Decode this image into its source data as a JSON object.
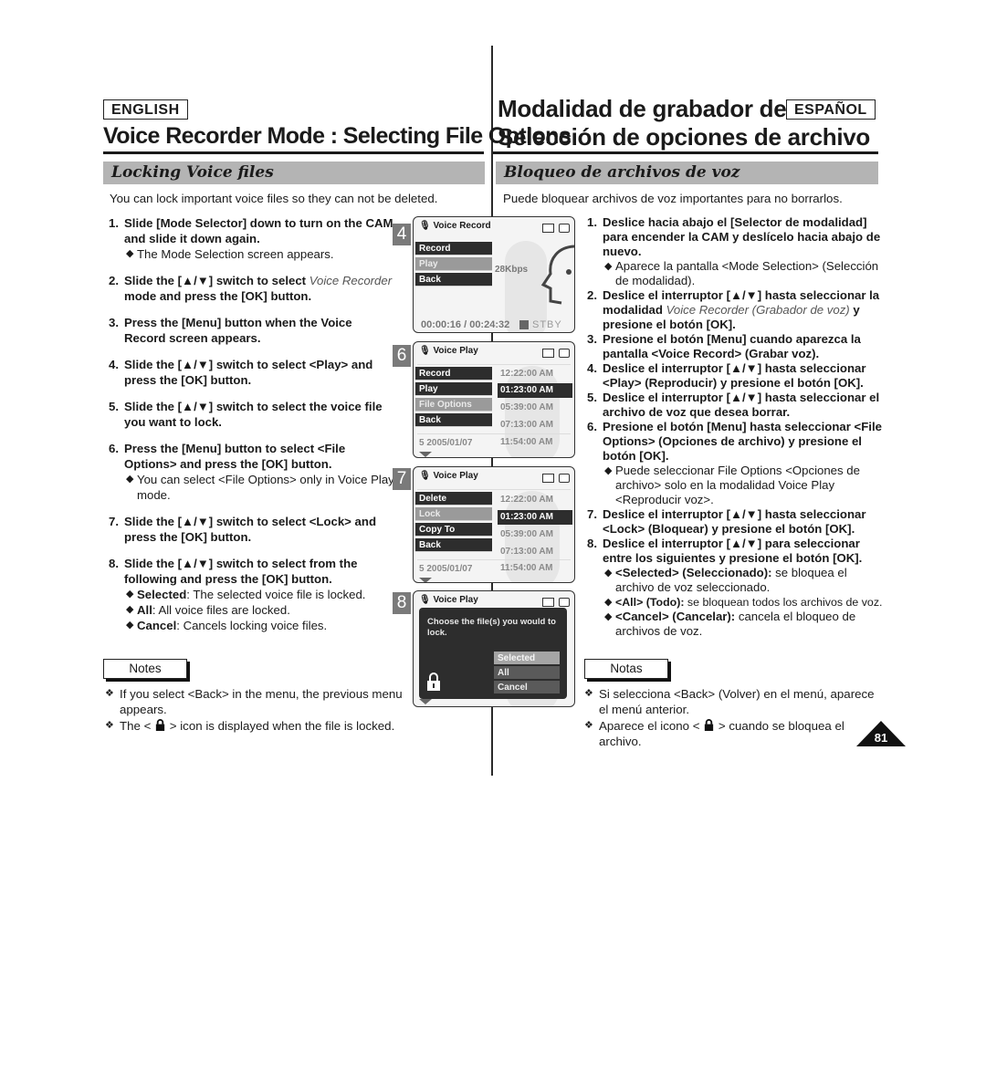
{
  "header": {
    "english_label": "ENGLISH",
    "spanish_label": "ESPAÑOL",
    "title_en": "Voice Recorder Mode : Selecting File Options",
    "title_es_line1": "Modalidad de grabador de voz:",
    "title_es_line2": "Selección de opciones de archivo"
  },
  "english": {
    "section_title": "Locking Voice files",
    "intro": "You can lock important voice files so they can not be deleted.",
    "steps": [
      {
        "num": "1.",
        "text": "Slide [Mode Selector] down to turn on the CAM and slide it down again.",
        "subs": [
          "The Mode Selection screen appears."
        ]
      },
      {
        "num": "2.",
        "pre": "Slide the [▲/▼] switch to select ",
        "italic": "Voice Recorder",
        "post": " mode and press the [OK] button."
      },
      {
        "num": "3.",
        "text": "Press the [Menu] button when the Voice Record screen appears."
      },
      {
        "num": "4.",
        "text": "Slide the [▲/▼] switch to select <Play> and press the [OK] button."
      },
      {
        "num": "5.",
        "text": "Slide the [▲/▼] switch to select the voice file you want to lock."
      },
      {
        "num": "6.",
        "text": "Press the [Menu] button to select <File Options> and press the [OK] button.",
        "subs": [
          "You can select <File Options> only in Voice Play mode."
        ]
      },
      {
        "num": "7.",
        "text": "Slide the [▲/▼] switch to select <Lock> and press the [OK] button."
      },
      {
        "num": "8.",
        "text": "Slide the [▲/▼] switch to select from the following and press the [OK] button.",
        "options": [
          {
            "term": "Selected",
            "desc": ": The selected voice file is locked."
          },
          {
            "term": "All",
            "desc": ": All voice files are locked."
          },
          {
            "term": "Cancel",
            "desc": ": Cancels locking voice files."
          }
        ]
      }
    ],
    "notes_label": "Notes",
    "notes": [
      "If you select <Back> in the menu, the previous menu appears.",
      {
        "pre": "The < ",
        "icon": "lock-icon",
        "post": " > icon is displayed when the file is locked."
      }
    ]
  },
  "spanish": {
    "section_title": "Bloqueo de archivos de voz",
    "intro": "Puede bloquear archivos de voz importantes para no borrarlos.",
    "steps": [
      {
        "num": "1.",
        "text": "Deslice hacia abajo el [Selector de modalidad] para encender la CAM y deslícelo hacia abajo de nuevo.",
        "subs": [
          "Aparece la pantalla <Mode Selection> (Selección de modalidad)."
        ]
      },
      {
        "num": "2.",
        "pre": "Deslice el interruptor [▲/▼] hasta seleccionar la modalidad ",
        "italic": "Voice Recorder (Grabador de voz)",
        "post": " y presione el botón [OK]."
      },
      {
        "num": "3.",
        "text": "Presione el botón [Menu] cuando aparezca la pantalla <Voice Record> (Grabar voz)."
      },
      {
        "num": "4.",
        "text": "Deslice el interruptor [▲/▼] hasta seleccionar <Play> (Reproducir) y presione el botón [OK]."
      },
      {
        "num": "5.",
        "text": "Deslice el interruptor [▲/▼] hasta seleccionar el archivo de voz que desea borrar."
      },
      {
        "num": "6.",
        "text": "Presione el botón [Menu] hasta seleccionar <File Options> (Opciones de archivo) y presione el botón [OK].",
        "subs": [
          "Puede seleccionar File Options <Opciones de archivo> solo en la modalidad Voice Play <Reproducir voz>."
        ]
      },
      {
        "num": "7.",
        "text": "Deslice el interruptor [▲/▼] hasta seleccionar <Lock> (Bloquear) y presione el botón [OK]."
      },
      {
        "num": "8.",
        "text": "Deslice el interruptor [▲/▼] para seleccionar entre los siguientes y presione el botón [OK].",
        "options": [
          {
            "term": "<Selected> (Seleccionado):",
            "desc": " se bloquea el archivo de voz seleccionado."
          },
          {
            "term": "<All> (Todo):",
            "desc": " se bloquean todos los archivos de voz."
          },
          {
            "term": "<Cancel> (Cancelar):",
            "desc": " cancela el bloqueo de archivos de voz."
          }
        ]
      }
    ],
    "notes_label": "Notas",
    "notes": [
      "Si selecciona <Back> (Volver) en el menú, aparece el menú anterior.",
      {
        "pre": "Aparece el icono < ",
        "icon": "lock-icon",
        "post": " > cuando se bloquea el archivo."
      }
    ]
  },
  "screens": [
    {
      "step": "4",
      "title": "Voice Record",
      "menu": [
        "Record",
        "Play",
        "Back"
      ],
      "menu_selected": 1,
      "bitrate_fragment": "28Kbps",
      "time_readout": "00:00:16 / 00:24:32",
      "status": "STBY"
    },
    {
      "step": "6",
      "title": "Voice Play",
      "menu": [
        "Record",
        "Play",
        "File Options",
        "Back"
      ],
      "menu_selected": 2,
      "times": [
        "12:22:00 AM",
        "01:23:00 AM",
        "05:39:00 AM",
        "07:13:00 AM",
        "11:54:00 AM"
      ],
      "time_selected": 1,
      "last_row_label": "5  2005/01/07"
    },
    {
      "step": "7",
      "title": "Voice Play",
      "menu": [
        "Delete",
        "Lock",
        "Copy To",
        "Back"
      ],
      "menu_selected": 1,
      "times": [
        "12:22:00 AM",
        "01:23:00 AM",
        "05:39:00 AM",
        "07:13:00 AM",
        "11:54:00 AM"
      ],
      "time_selected": 1,
      "last_row_label": "5  2005/01/07"
    },
    {
      "step": "8",
      "title": "Voice Play",
      "dialog_message": "Choose the file(s) you would to lock.",
      "options": [
        "Selected",
        "All",
        "Cancel"
      ],
      "option_selected": 0
    }
  ],
  "page_number": "81"
}
